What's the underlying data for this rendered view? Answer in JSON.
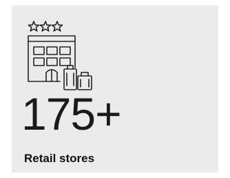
{
  "card": {
    "icon": "hotel-building-luggage-icon",
    "value": "175+",
    "label": "Retail stores",
    "colors": {
      "background": "#ebebeb",
      "text": "#111111",
      "icon_stroke": "#222222"
    }
  }
}
